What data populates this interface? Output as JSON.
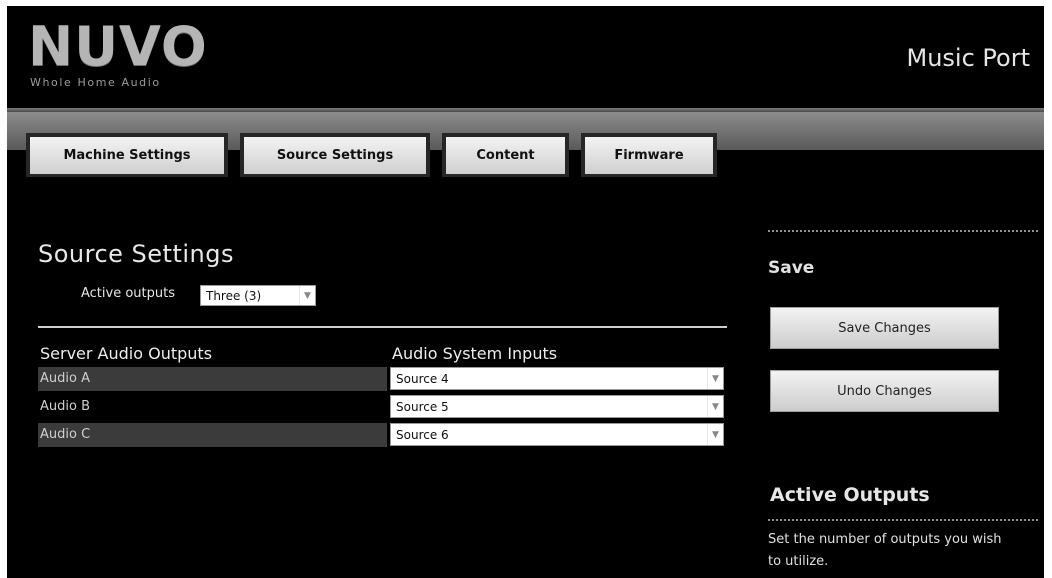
{
  "header": {
    "logo_text": "NUVO",
    "logo_tagline": "Whole Home Audio",
    "product_name": "Music Port"
  },
  "tabs": [
    {
      "label": "Machine Settings"
    },
    {
      "label": "Source Settings"
    },
    {
      "label": "Content"
    },
    {
      "label": "Firmware"
    }
  ],
  "main": {
    "title": "Source Settings",
    "active_outputs_label": "Active outputs",
    "active_outputs_value": "Three (3)",
    "col_outputs": "Server Audio Outputs",
    "col_inputs": "Audio System Inputs",
    "rows": [
      {
        "output": "Audio A",
        "input": "Source 4"
      },
      {
        "output": "Audio B",
        "input": "Source 5"
      },
      {
        "output": "Audio C",
        "input": "Source 6"
      }
    ]
  },
  "sidebar": {
    "save_title": "Save",
    "save_button": "Save Changes",
    "undo_button": "Undo Changes",
    "help_title": "Active Outputs",
    "help_text": "Set the number of outputs you wish to utilize."
  },
  "colors": {
    "background": "#000000",
    "tab_face": "#e6e6e6",
    "row_shade": "#3b3b3b"
  }
}
